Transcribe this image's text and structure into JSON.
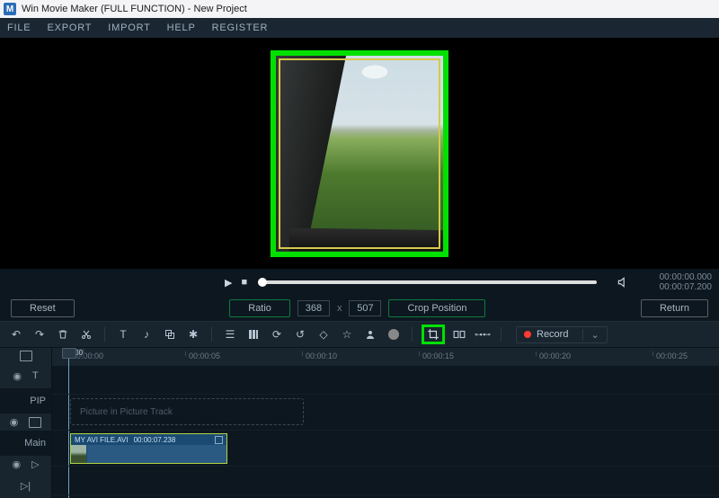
{
  "titlebar": {
    "app_name": "Win Movie Maker (FULL FUNCTION)",
    "doc": "New Project"
  },
  "menu": {
    "file": "FILE",
    "export": "EXPORT",
    "import": "IMPORT",
    "help": "HELP",
    "register": "REGISTER"
  },
  "playback": {
    "cur": "00:00:00.000",
    "dur": "00:00:07.200"
  },
  "crop": {
    "reset": "Reset",
    "ratio_label": "Ratio",
    "w": "368",
    "h": "507",
    "pos_label": "Crop Position",
    "return_label": "Return"
  },
  "toolbar": {
    "record": "Record"
  },
  "ruler": {
    "t0": "00:00:00",
    "t1": "00:00:05",
    "t2": "00:00:10",
    "t3": "00:00:15",
    "t4": "00:00:20",
    "t5": "00:00:25"
  },
  "playhead": "00:00",
  "tracks": {
    "pip_label": "PIP",
    "main_label": "Main",
    "pip_placeholder": "Picture in Picture Track"
  },
  "clip": {
    "name": "MY AVI FILE.AVI",
    "dur": "00:00:07.238"
  }
}
